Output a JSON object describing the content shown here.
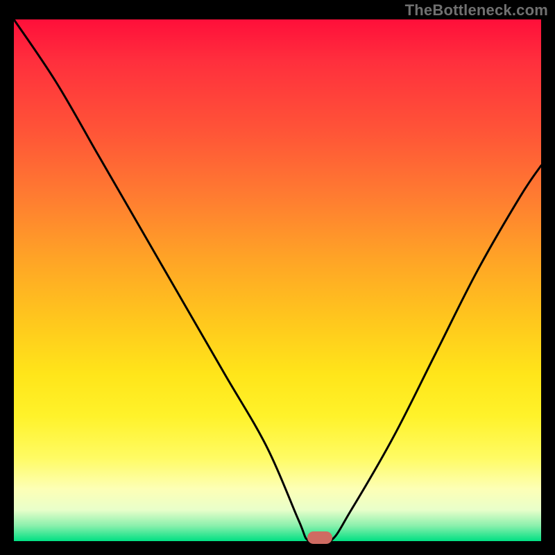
{
  "watermark": "TheBottleneck.com",
  "chart_data": {
    "type": "line",
    "title": "",
    "xlabel": "",
    "ylabel": "",
    "xlim": [
      0,
      100
    ],
    "ylim": [
      0,
      100
    ],
    "grid": false,
    "legend": false,
    "series": [
      {
        "name": "bottleneck-curve",
        "x": [
          0,
          8,
          16,
          24,
          32,
          40,
          48,
          54,
          56,
          60,
          64,
          72,
          80,
          88,
          96,
          100
        ],
        "values": [
          100,
          88,
          74,
          60,
          46,
          32,
          18,
          4,
          0,
          0,
          6,
          20,
          36,
          52,
          66,
          72
        ]
      }
    ],
    "minimum_marker": {
      "x": 58,
      "y": 0
    },
    "colors": {
      "curve": "#000000",
      "marker": "#cf6b62",
      "gradient_top": "#ff0f3a",
      "gradient_bottom": "#00e083"
    }
  }
}
